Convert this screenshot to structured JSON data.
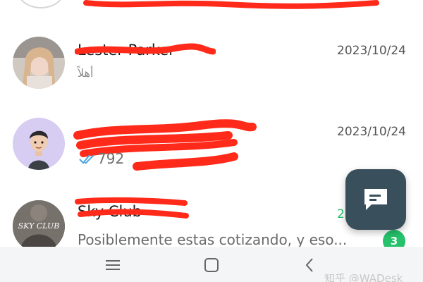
{
  "chats": [
    {
      "name": "Lester Parker",
      "date": "2023/10/24",
      "preview": "أهلاً",
      "avatar": "woman-photo-avatar"
    },
    {
      "name": "",
      "date": "2023/10/24",
      "preview": "792",
      "read_receipt": "double-check-icon",
      "avatar": "cartoon-man-avatar"
    },
    {
      "name": "Sky Club",
      "date": "2",
      "preview": "Posiblemente estas cotizando, y eso...",
      "unread_count": "3",
      "avatar_text": "SKY CLUB"
    }
  ],
  "fab": {
    "icon": "new-chat-icon"
  },
  "navbar": {
    "buttons": [
      "menu-icon",
      "home-square-icon",
      "back-chevron-icon"
    ]
  },
  "watermark": "知乎 @WADesk",
  "colors": {
    "redaction": "#ff2a1a",
    "accent_green": "#25c26b",
    "fab_bg": "#3a4f5c",
    "tick_blue": "#4aa3df"
  }
}
